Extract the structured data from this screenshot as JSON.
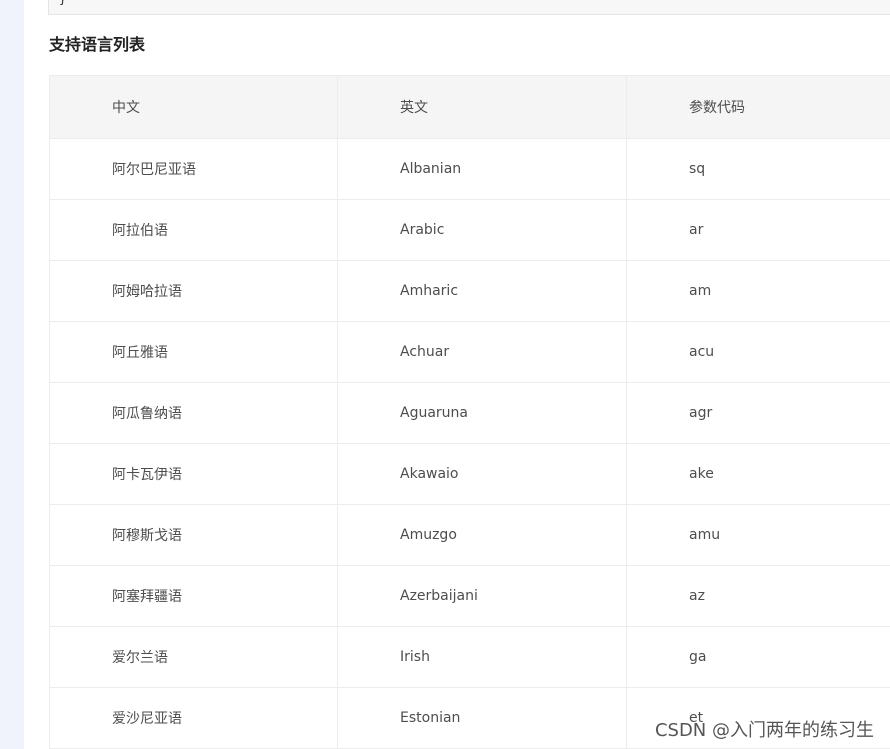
{
  "code_block": {
    "tail_text": "}"
  },
  "section": {
    "title": "支持语言列表"
  },
  "table": {
    "headers": [
      "中文",
      "英文",
      "参数代码"
    ],
    "rows": [
      [
        "阿尔巴尼亚语",
        "Albanian",
        "sq"
      ],
      [
        "阿拉伯语",
        "Arabic",
        "ar"
      ],
      [
        "阿姆哈拉语",
        "Amharic",
        "am"
      ],
      [
        "阿丘雅语",
        "Achuar",
        "acu"
      ],
      [
        "阿瓜鲁纳语",
        "Aguaruna",
        "agr"
      ],
      [
        "阿卡瓦伊语",
        "Akawaio",
        "ake"
      ],
      [
        "阿穆斯戈语",
        "Amuzgo",
        "amu"
      ],
      [
        "阿塞拜疆语",
        "Azerbaijani",
        "az"
      ],
      [
        "爱尔兰语",
        "Irish",
        "ga"
      ],
      [
        "爱沙尼亚语",
        "Estonian",
        "et"
      ]
    ]
  },
  "watermark": {
    "text": "CSDN @入门两年的练习生"
  }
}
